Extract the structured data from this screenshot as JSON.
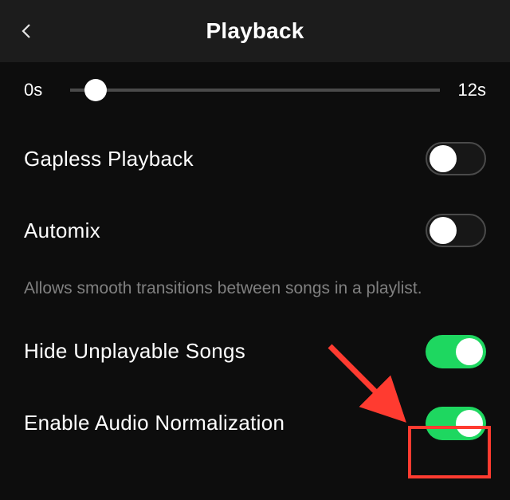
{
  "header": {
    "title": "Playback"
  },
  "slider": {
    "min_label": "0s",
    "max_label": "12s",
    "value_percent": 7
  },
  "settings": {
    "gapless": {
      "label": "Gapless Playback",
      "on": false
    },
    "automix": {
      "label": "Automix",
      "on": false,
      "description": "Allows smooth transitions between songs in a playlist."
    },
    "hide": {
      "label": "Hide Unplayable Songs",
      "on": true
    },
    "normalize": {
      "label": "Enable Audio Normalization",
      "on": true
    }
  }
}
